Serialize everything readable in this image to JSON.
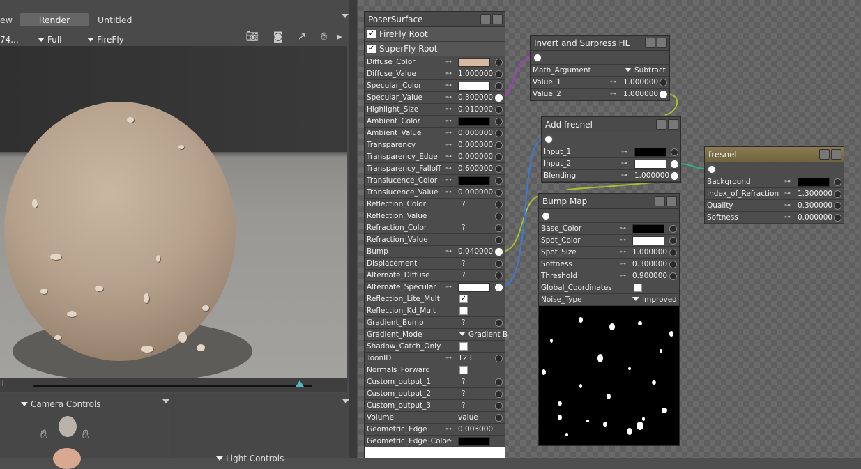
{
  "left_panel": {
    "tabs": {
      "partial": "ew",
      "render": "Render",
      "untitled": "Untitled"
    },
    "toolbar": {
      "camera_partial": "74...",
      "size": "Full",
      "renderer": "FireFly"
    },
    "timeline_label": "ll",
    "camera_controls_title": "Camera Controls",
    "light_controls_title": "Light Controls"
  },
  "poser_surface": {
    "title": "PoserSurface",
    "root_rows": [
      {
        "label": "FireFly Root",
        "checked": true
      },
      {
        "label": "SuperFly Root",
        "checked": true
      }
    ],
    "rows": [
      {
        "label": "Diffuse_Color",
        "key": true,
        "swatch": "#d8b9a0",
        "port": "open"
      },
      {
        "label": "Diffuse_Value",
        "key": true,
        "value": "1.000000",
        "port": "open"
      },
      {
        "label": "Specular_Color",
        "key": true,
        "swatch": "#ffffff",
        "port": "open"
      },
      {
        "label": "Specular_Value",
        "key": true,
        "value": "0.300000",
        "port": "conn"
      },
      {
        "label": "Highlight_Size",
        "key": true,
        "value": "0.010000",
        "port": "open"
      },
      {
        "label": "Ambient_Color",
        "key": true,
        "swatch": "#000000",
        "port": "open"
      },
      {
        "label": "Ambient_Value",
        "key": true,
        "value": "0.000000",
        "port": "open"
      },
      {
        "label": "Transparency",
        "key": true,
        "value": "0.000000",
        "port": "open"
      },
      {
        "label": "Transparency_Edge",
        "key": true,
        "value": "0.000000",
        "port": "open"
      },
      {
        "label": "Transparency_Falloff",
        "key": true,
        "value": "0.600000",
        "port": "open"
      },
      {
        "label": "Translucence_Color",
        "key": true,
        "swatch": "#000000",
        "port": "open"
      },
      {
        "label": "Translucence_Value",
        "key": true,
        "value": "0.000000",
        "port": "open"
      },
      {
        "label": "Reflection_Color",
        "q": "?",
        "port": "open"
      },
      {
        "label": "Reflection_Value",
        "port": "open"
      },
      {
        "label": "Refraction_Color",
        "q": "?",
        "port": "open"
      },
      {
        "label": "Refraction_Value",
        "port": "open"
      },
      {
        "label": "Bump",
        "key": true,
        "value": "0.040000",
        "port": "conn"
      },
      {
        "label": "Displacement",
        "q": "?",
        "port": "open"
      },
      {
        "label": "Alternate_Diffuse",
        "q": "?",
        "port": "open"
      },
      {
        "label": "Alternate_Specular",
        "key": true,
        "swatch": "#ffffff",
        "port": "conn"
      },
      {
        "label": "Reflection_Lite_Mult",
        "checkbox": true,
        "checked": true
      },
      {
        "label": "Reflection_Kd_Mult",
        "checkbox": true,
        "checked": false
      },
      {
        "label": "Gradient_Bump",
        "q": "?",
        "port": "open"
      },
      {
        "label": "Gradient_Mode",
        "dropdown": "Gradient B"
      },
      {
        "label": "Shadow_Catch_Only",
        "checkbox": true,
        "checked": false
      },
      {
        "label": "ToonID",
        "key": true,
        "value": "123",
        "port": "open"
      },
      {
        "label": "Normals_Forward",
        "checkbox": true,
        "checked": false
      },
      {
        "label": "Custom_output_1",
        "q": "?",
        "port": "open"
      },
      {
        "label": "Custom_output_2",
        "q": "?",
        "port": "open"
      },
      {
        "label": "Custom_output_3",
        "q": "?",
        "port": "open"
      },
      {
        "label": "Volume",
        "text": "value",
        "port": "open"
      },
      {
        "label": "Geometric_Edge",
        "key": true,
        "value": "0.003000"
      },
      {
        "label": "Geometric_Edge_Color",
        "key": true,
        "swatch": "#000000"
      }
    ]
  },
  "invert_node": {
    "title": "Invert and Surpress HL",
    "rows": [
      {
        "label": "Math_Argument",
        "dropdown": "Subtract"
      },
      {
        "label": "Value_1",
        "key": true,
        "value": "1.000000",
        "port": "open"
      },
      {
        "label": "Value_2",
        "key": true,
        "value": "1.000000",
        "port": "conn"
      }
    ]
  },
  "add_fresnel_node": {
    "title": "Add fresnel",
    "rows": [
      {
        "label": "Input_1",
        "key": true,
        "swatch": "#000000",
        "port": "open"
      },
      {
        "label": "Input_2",
        "key": true,
        "swatch": "#ffffff",
        "port": "conn"
      },
      {
        "label": "Blending",
        "key": true,
        "value": "1.000000",
        "port": "conn"
      }
    ]
  },
  "fresnel_node": {
    "title": "fresnel",
    "title_color": "#8a7a4f",
    "rows": [
      {
        "label": "Background",
        "key": true,
        "swatch": "#000000",
        "port": "open"
      },
      {
        "label": "Index_of_Refraction",
        "key": true,
        "value": "1.300000",
        "port": "open"
      },
      {
        "label": "Quality",
        "key": true,
        "value": "0.300000",
        "port": "open"
      },
      {
        "label": "Softness",
        "key": true,
        "value": "0.000000",
        "port": "open"
      }
    ]
  },
  "bump_map_node": {
    "title": "Bump Map",
    "rows": [
      {
        "label": "Base_Color",
        "key": true,
        "swatch": "#000000",
        "port": "open"
      },
      {
        "label": "Spot_Color",
        "key": true,
        "swatch": "#ffffff",
        "port": "open"
      },
      {
        "label": "Spot_Size",
        "key": true,
        "value": "1.000000",
        "port": "open"
      },
      {
        "label": "Softness",
        "key": true,
        "value": "0.300000",
        "port": "open"
      },
      {
        "label": "Threshold",
        "key": true,
        "value": "0.900000",
        "port": "open"
      },
      {
        "label": "Global_Coordinates",
        "checkbox": true,
        "checked": false
      },
      {
        "label": "Noise_Type",
        "dropdown": "Improved"
      }
    ]
  },
  "colors": {
    "wire_purple": "#a040c0",
    "wire_green": "#a8c030",
    "wire_blue": "#3a7ad8",
    "wire_teal": "#30b080"
  }
}
